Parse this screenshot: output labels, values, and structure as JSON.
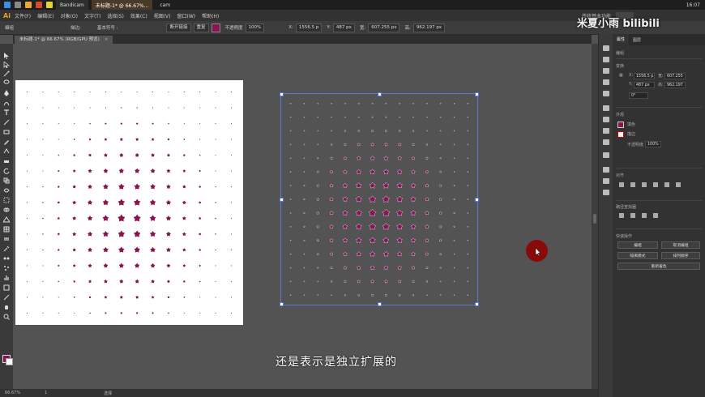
{
  "taskbar": {
    "tasks": [
      "Bandicam",
      "未标题-1* @ 66.67%...",
      "cam"
    ],
    "clock": "16:07"
  },
  "menubar": {
    "logo": "Ai",
    "items": [
      "文件(F)",
      "编辑(E)",
      "对象(O)",
      "文字(T)",
      "选择(S)",
      "效果(C)",
      "视图(V)",
      "窗口(W)",
      "帮助(H)"
    ],
    "workspace": "传统基本功能"
  },
  "controlbar": {
    "label": "编组",
    "stroke_label": "描边:",
    "brush_label": "基本符号 :",
    "style_btn": "断开链接",
    "opacity_label": "不透明度",
    "opacity": "100%",
    "mode_btn": "重复",
    "x_label": "X:",
    "x": "1556.5 p",
    "y_label": "Y:",
    "y": "487 px",
    "w_label": "宽:",
    "w": "607.255 px",
    "h_label": "高:",
    "h": "962.197 px"
  },
  "document": {
    "tab_title": "未标题-1* @ 66.67% (RGB/GPU 预览)",
    "close": "×"
  },
  "subtitle": "还是表示是独立扩展的",
  "watermark": "米夏小雨 bilibili",
  "statusbar": {
    "zoom": "66.67%",
    "page": "1",
    "tool": "选择"
  },
  "panel": {
    "tabs": [
      "属性",
      "图层"
    ],
    "section_group": "编组",
    "section_transform": "变换",
    "x_label": "X:",
    "x": "1556.5 p",
    "w_label": "宽:",
    "w": "607.255",
    "y_label": "Y:",
    "y": "487 px",
    "h_label": "高:",
    "h": "962.197",
    "angle": "0°",
    "section_appearance": "外观",
    "fill_label": "填色",
    "stroke_label": "描边",
    "opacity_label": "不透明度",
    "opacity": "100%",
    "section_align": "对齐",
    "section_pathfinder": "路径查找器",
    "section_quick": "快速操作",
    "btn_ungroup": "取消编组",
    "btn_isolate": "隔离模式",
    "btn_edit": "重新着色",
    "btn_group": "编组",
    "btn_arrange": "排列顺序",
    "btn_recolor": "重新着色"
  },
  "colors": {
    "accent": "#8b1450",
    "selection": "#5a78d6",
    "canvas": "#535353"
  }
}
